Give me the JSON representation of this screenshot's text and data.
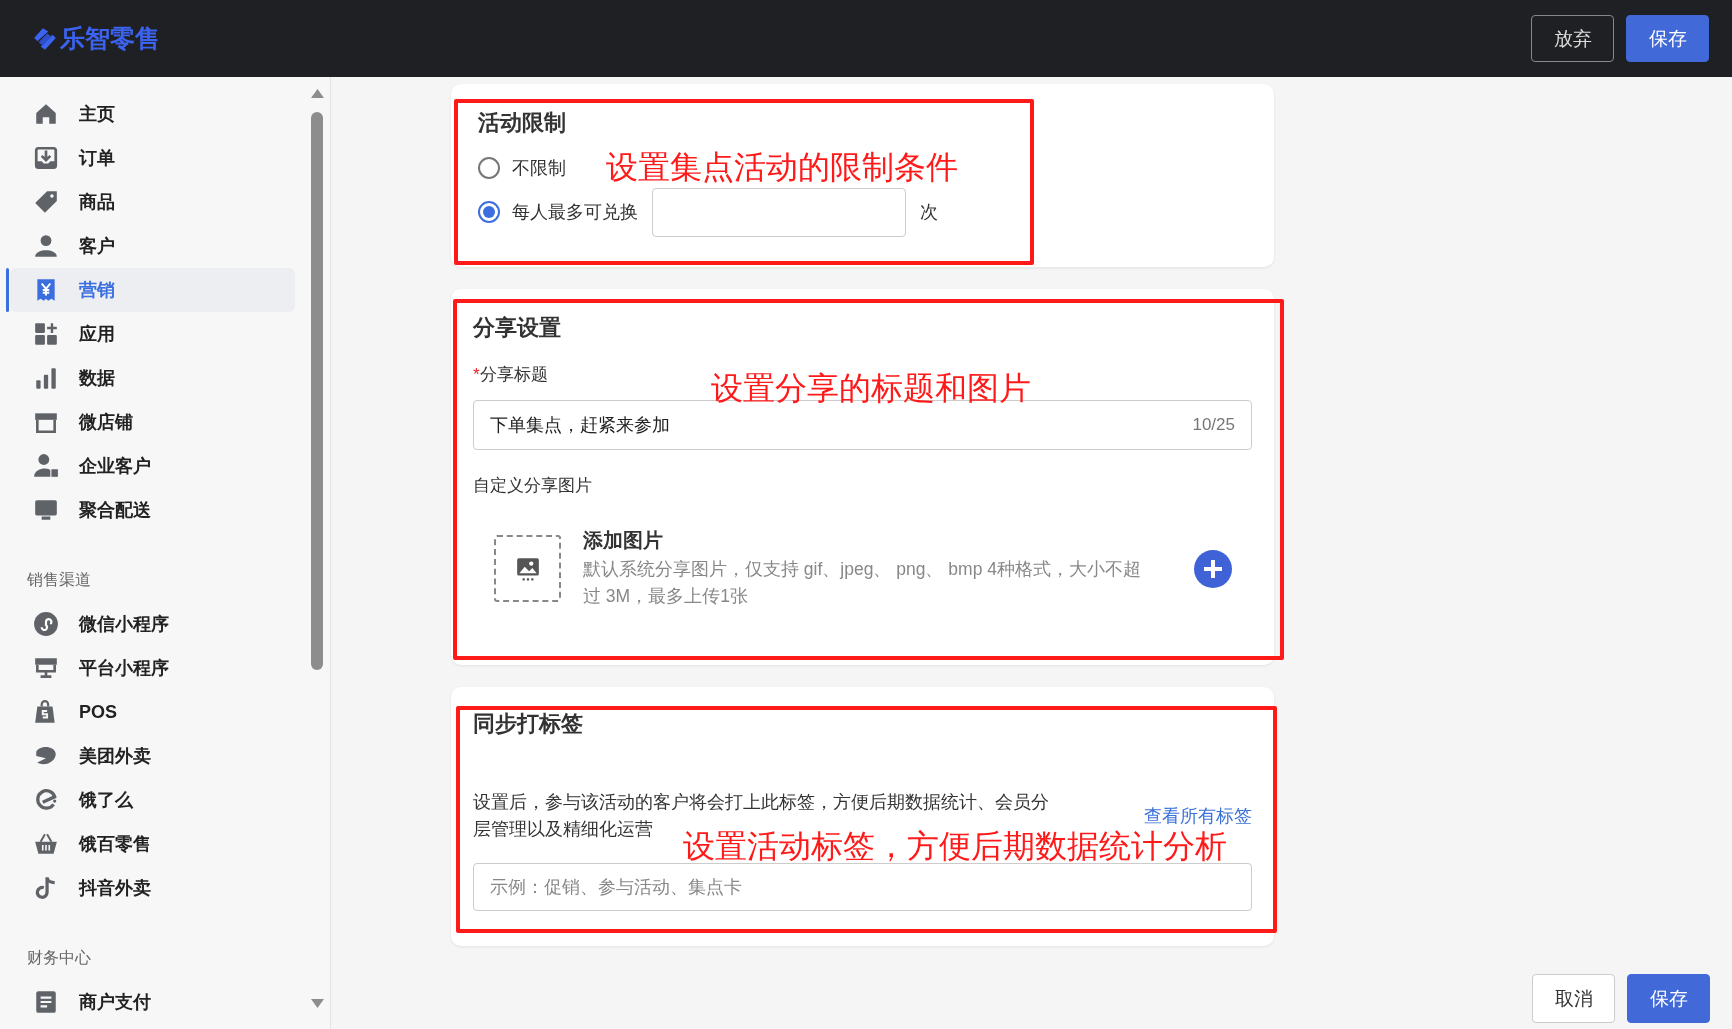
{
  "header": {
    "logo": "乐智零售",
    "buttons": [
      {
        "label": "放弃",
        "kind": "outline"
      },
      {
        "label": "保存",
        "kind": "primary"
      }
    ]
  },
  "sidebar": {
    "sections": [
      {
        "items": [
          {
            "label": "主页",
            "selected": false
          },
          {
            "label": "订单",
            "selected": false
          },
          {
            "label": "商品",
            "selected": false
          },
          {
            "label": "客户",
            "selected": false
          },
          {
            "label": "营销",
            "selected": true
          },
          {
            "label": "应用",
            "selected": false
          },
          {
            "label": "数据",
            "selected": false
          },
          {
            "label": "微店铺",
            "selected": false
          },
          {
            "label": "企业客户",
            "selected": false
          },
          {
            "label": "聚合配送",
            "selected": false
          }
        ]
      },
      {
        "title": "销售渠道",
        "items": [
          {
            "label": "微信小程序",
            "selected": false
          },
          {
            "label": "平台小程序",
            "selected": false
          },
          {
            "label": "POS",
            "selected": false
          },
          {
            "label": "美团外卖",
            "selected": false
          },
          {
            "label": "饿了么",
            "selected": false
          },
          {
            "label": "饿百零售",
            "selected": false
          },
          {
            "label": "抖音外卖",
            "selected": false
          }
        ]
      },
      {
        "title": "财务中心",
        "items": [
          {
            "label": "商户支付",
            "selected": false
          }
        ]
      }
    ]
  },
  "limit_card": {
    "title": "活动限制",
    "options": [
      {
        "label": "不限制",
        "selected": false
      },
      {
        "label": "每人最多可兑换",
        "selected": true
      }
    ],
    "unit": "次",
    "annotation": "设置集点活动的限制条件"
  },
  "share_card": {
    "title": "分享设置",
    "required_mark": "*",
    "title_label": "分享标题",
    "title_value": "下单集点，赶紧来参加",
    "counter": "10/25",
    "image_label": "自定义分享图片",
    "upload_title": "添加图片",
    "upload_hint": "默认系统分享图片，仅支持 gif、jpeg、 png、 bmp 4种格式，大小不超过 3M，最多上传1张",
    "annotation": "设置分享的标题和图片"
  },
  "tag_card": {
    "title": "同步打标签",
    "description": "设置后，参与该活动的客户将会打上此标签，方便后期数据统计、会员分层管理以及精细化运营",
    "link": "查看所有标签",
    "placeholder": "示例：促销、参与活动、集点卡",
    "annotation": "设置活动标签，方便后期数据统计分析"
  },
  "footer": {
    "buttons": [
      {
        "label": "取消",
        "kind": "outline"
      },
      {
        "label": "保存",
        "kind": "primary"
      }
    ]
  }
}
